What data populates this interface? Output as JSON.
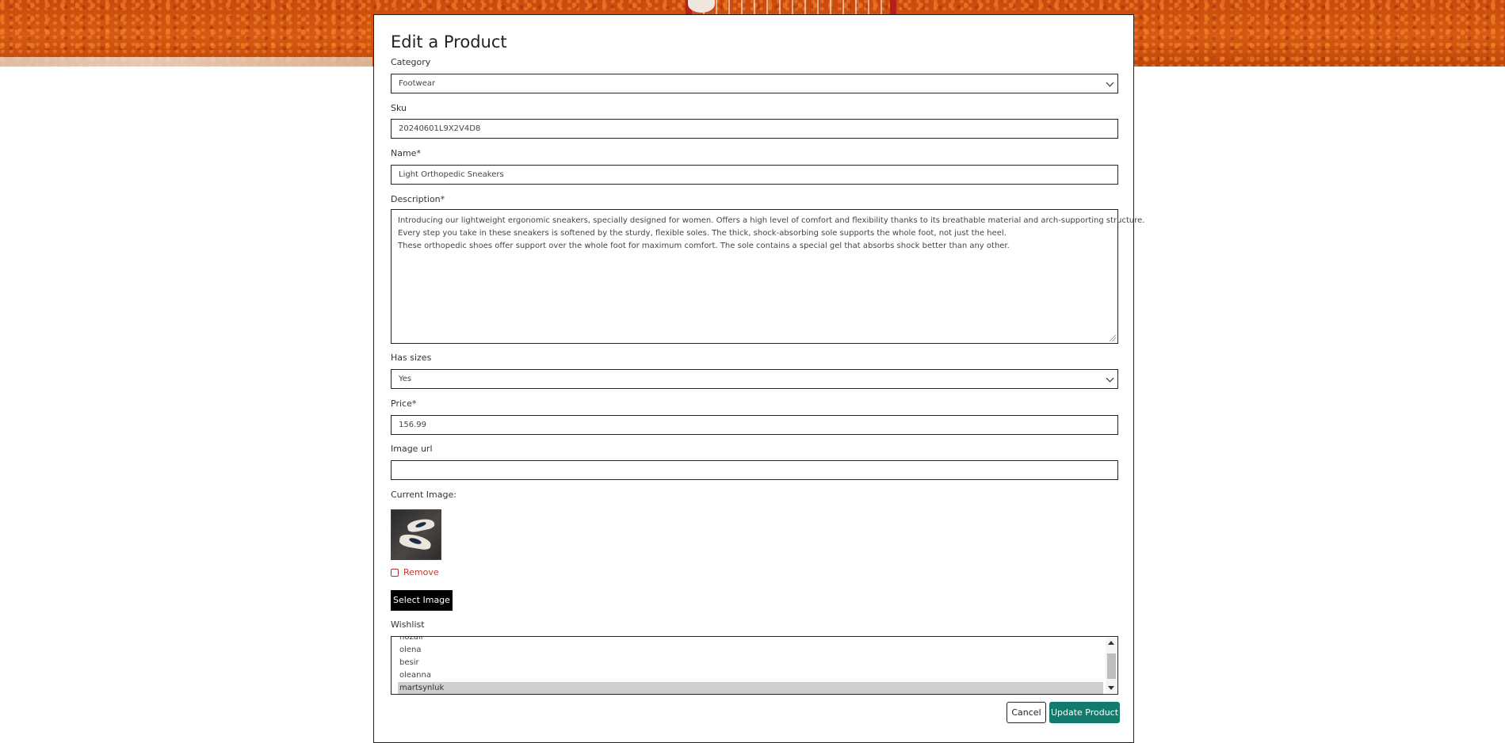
{
  "page": {
    "title": "Edit a Product"
  },
  "form": {
    "category": {
      "label": "Category",
      "value": "Footwear"
    },
    "sku": {
      "label": "Sku",
      "value": "20240601L9X2V4D8"
    },
    "name": {
      "label": "Name*",
      "value": "Light Orthopedic Sneakers"
    },
    "description": {
      "label": "Description*",
      "lines": [
        "Introducing our lightweight ergonomic sneakers, specially designed for women. Offers a high level of comfort and flexibility thanks to its breathable material and arch-supporting structure.",
        "Every step you take in these sneakers is softened by the sturdy, flexible soles. The thick, shock-absorbing sole supports the whole foot, not just the heel.",
        "These orthopedic shoes offer support over the whole foot for maximum comfort. The sole contains a special gel that absorbs shock better than any other."
      ]
    },
    "has_sizes": {
      "label": "Has sizes",
      "value": "Yes"
    },
    "price": {
      "label": "Price*",
      "value": "156.99"
    },
    "image_url": {
      "label": "Image url",
      "value": ""
    },
    "current_image": {
      "label": "Current Image:",
      "remove_label": "Remove"
    },
    "select_image_label": "Select Image",
    "wishlist": {
      "label": "Wishlist",
      "items": [
        "nozali",
        "olena",
        "besir",
        "oleanna",
        "martsynluk"
      ],
      "selected": "martsynluk"
    }
  },
  "actions": {
    "cancel_label": "Cancel",
    "update_label": "Update Product"
  },
  "colors": {
    "update_button": "#127b6b",
    "remove_text": "#c0392b",
    "hero_clay": "#d75a12"
  },
  "icons": {
    "select_chevron": "chevron-down-icon",
    "scroll_up": "arrow-up-icon",
    "scroll_down": "arrow-down-icon"
  }
}
